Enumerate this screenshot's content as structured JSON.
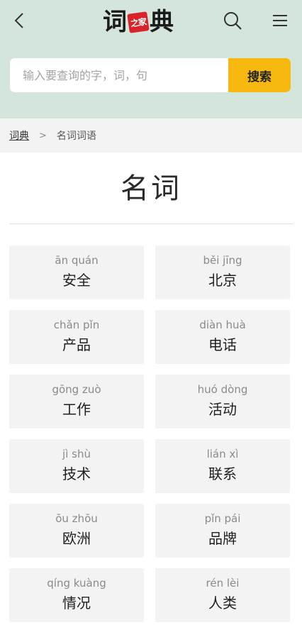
{
  "header": {
    "logo": {
      "char1": "词",
      "badge": "之家",
      "char2": "典"
    },
    "search": {
      "placeholder": "输入要查询的字，词，句",
      "value": "",
      "button_label": "搜索"
    }
  },
  "breadcrumb": {
    "home": "词典",
    "separator": ">",
    "current": "名词词语"
  },
  "page_title": "名词",
  "words": [
    {
      "pinyin": "ān quán",
      "word": "安全"
    },
    {
      "pinyin": "běi jīng",
      "word": "北京"
    },
    {
      "pinyin": "chǎn pǐn",
      "word": "产品"
    },
    {
      "pinyin": "diàn huà",
      "word": "电话"
    },
    {
      "pinyin": "gōng zuò",
      "word": "工作"
    },
    {
      "pinyin": "huó dòng",
      "word": "活动"
    },
    {
      "pinyin": "jì shù",
      "word": "技术"
    },
    {
      "pinyin": "lián xì",
      "word": "联系"
    },
    {
      "pinyin": "ōu zhōu",
      "word": "欧洲"
    },
    {
      "pinyin": "pǐn pái",
      "word": "品牌"
    },
    {
      "pinyin": "qíng kuàng",
      "word": "情况"
    },
    {
      "pinyin": "rén lèi",
      "word": "人类"
    }
  ],
  "colors": {
    "header_bg": "#d4e5dc",
    "search_button": "#f7b90f",
    "logo_badge": "#d8232a",
    "card_bg": "#f3f3f3"
  },
  "icons": [
    "back-arrow-icon",
    "search-icon",
    "hamburger-menu-icon"
  ]
}
